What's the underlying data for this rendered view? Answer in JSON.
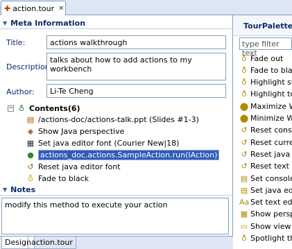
{
  "tab": {
    "label": "action.tour",
    "close": "✕"
  },
  "meta": {
    "header": "Meta Information",
    "title_label": "Title:",
    "title_value": "actions walkthrough",
    "description_label": "Description:",
    "description_value": "talks about how to add actions to my workbench",
    "author_label": "Author:",
    "author_value": "Li-Te Cheng"
  },
  "contents": {
    "label": "Contents(6)",
    "items": [
      {
        "text": "/actions-doc/actions-talk.ppt (Slides #1-3)",
        "icon": "slides-icon",
        "glyph": "▤"
      },
      {
        "text": "Show Java perspective",
        "icon": "perspective-icon",
        "glyph": "◈"
      },
      {
        "text": "Set java editor font (Courier New|18)",
        "icon": "font-icon",
        "glyph": "▦"
      },
      {
        "text": "actions_doc.actions.SampleAction.run(IAction)",
        "icon": "method-icon",
        "glyph": "●",
        "selected": true
      },
      {
        "text": "Reset java editor font",
        "icon": "reset-icon",
        "glyph": "↺"
      },
      {
        "text": "Fade to black",
        "icon": "bulb-icon",
        "glyph": "♁"
      }
    ]
  },
  "notes": {
    "header": "Notes",
    "value": "modify this method to execute your action"
  },
  "bottom_tabs": [
    "Design",
    "action.tour"
  ],
  "palette": {
    "title": "TourPalette",
    "filter_placeholder": "type filter text",
    "items": [
      {
        "text": "Fade out",
        "glyph": "♁"
      },
      {
        "text": "Fade to black",
        "glyph": "♁"
      },
      {
        "text": "Highlight state",
        "glyph": "♁"
      },
      {
        "text": "Highlight tool",
        "glyph": "♁"
      },
      {
        "text": "Maximize Wor",
        "glyph": "⬤"
      },
      {
        "text": "Minimize Wor",
        "glyph": "⬤"
      },
      {
        "text": "Reset console",
        "glyph": "↺"
      },
      {
        "text": "Reset current",
        "glyph": "↺"
      },
      {
        "text": "Reset java ed",
        "glyph": "↺"
      },
      {
        "text": "Reset text ed",
        "glyph": "↺"
      },
      {
        "text": "Set console fo",
        "glyph": "▤"
      },
      {
        "text": "Set java edito",
        "glyph": "▤"
      },
      {
        "text": "Set text editor",
        "glyph": "Aa"
      },
      {
        "text": "Show perspect",
        "glyph": "▦"
      },
      {
        "text": "Show view",
        "glyph": "▭"
      },
      {
        "text": "Spotlight the",
        "glyph": "♁"
      }
    ]
  },
  "colors": {
    "selection": "#2e5bb8",
    "header_text": "#0c2a6a",
    "border": "#7f9db9"
  }
}
